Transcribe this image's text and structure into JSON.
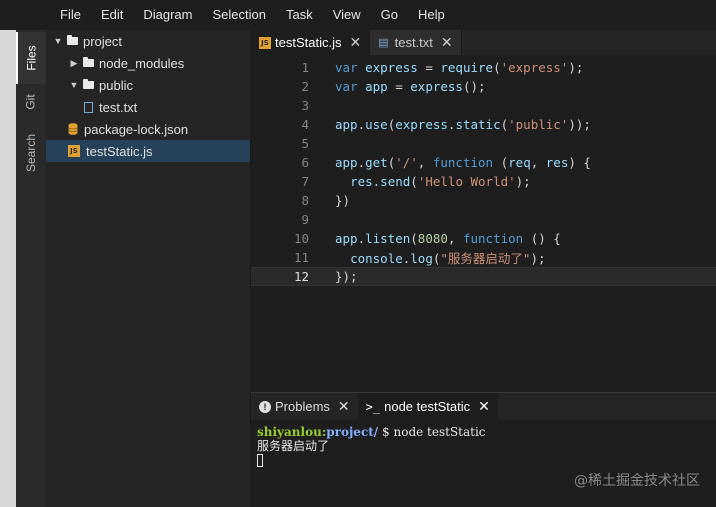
{
  "menu": [
    "File",
    "Edit",
    "Diagram",
    "Selection",
    "Task",
    "View",
    "Go",
    "Help"
  ],
  "activity_tabs": [
    "Files",
    "Git",
    "Search"
  ],
  "explorer": [
    {
      "label": "project",
      "kind": "folder",
      "expanded": true,
      "depth": 0
    },
    {
      "label": "node_modules",
      "kind": "folder",
      "expanded": false,
      "depth": 1
    },
    {
      "label": "public",
      "kind": "folder",
      "expanded": true,
      "depth": 1
    },
    {
      "label": "test.txt",
      "kind": "file",
      "depth": 2
    },
    {
      "label": "package-lock.json",
      "kind": "json",
      "depth": 1
    },
    {
      "label": "testStatic.js",
      "kind": "js",
      "depth": 1,
      "selected": true
    }
  ],
  "editor_tabs": [
    {
      "label": "testStatic.js",
      "active": true,
      "icon": "js-file-icon"
    },
    {
      "label": "test.txt",
      "active": false,
      "icon": "text-file-icon"
    }
  ],
  "code_lines": [
    {
      "n": "1",
      "text": "var express = require('express');"
    },
    {
      "n": "2",
      "text": "var app = express();"
    },
    {
      "n": "3",
      "text": ""
    },
    {
      "n": "4",
      "text": "app.use(express.static('public'));"
    },
    {
      "n": "5",
      "text": ""
    },
    {
      "n": "6",
      "text": "app.get('/', function (req, res) {"
    },
    {
      "n": "7",
      "text": "  res.send('Hello World');"
    },
    {
      "n": "8",
      "text": "})"
    },
    {
      "n": "9",
      "text": ""
    },
    {
      "n": "10",
      "text": "app.listen(8080, function () {"
    },
    {
      "n": "11",
      "text": "  console.log(\"服务器启动了\");"
    },
    {
      "n": "12",
      "text": "});"
    }
  ],
  "current_line": "12",
  "panel_tabs": [
    {
      "label": "Problems",
      "active": false
    },
    {
      "label": "node testStatic",
      "active": true
    }
  ],
  "terminal": {
    "user": "shiyanlou",
    "path": "project/",
    "prompt_symbol": "$",
    "command": "node testStatic",
    "output": "服务器启动了"
  },
  "watermark": "@稀土掘金技术社区"
}
